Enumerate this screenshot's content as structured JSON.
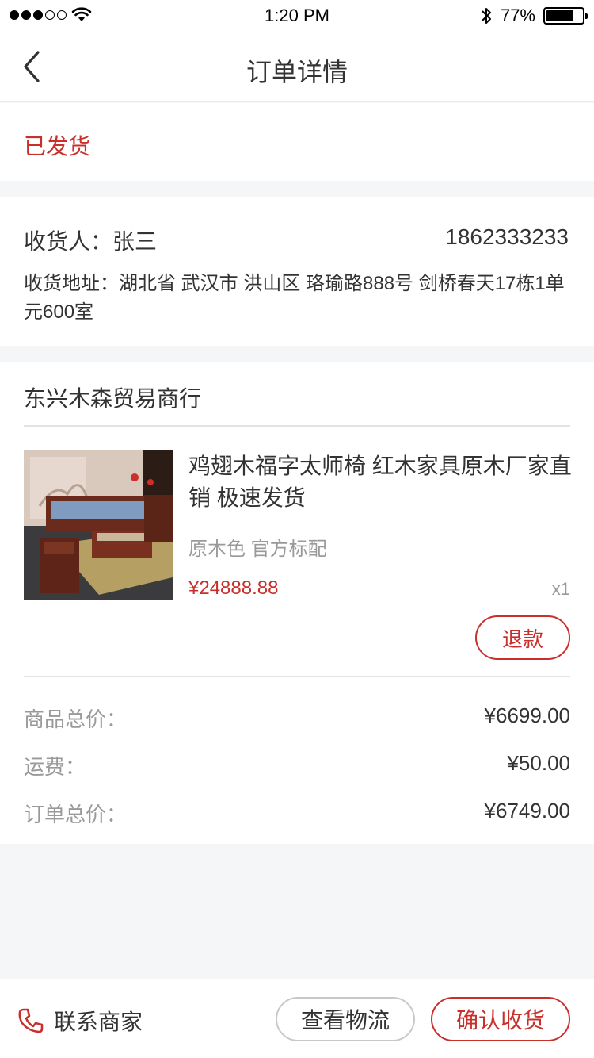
{
  "status_bar": {
    "signal_dots_filled": 3,
    "signal_dots_total": 5,
    "time": "1:20 PM",
    "battery_percent": "77%",
    "battery_level": 0.77
  },
  "nav": {
    "title": "订单详情",
    "back_icon": "chevron-left-icon"
  },
  "order": {
    "status": "已发货"
  },
  "receiver": {
    "name_label": "收货人：张三",
    "phone": "1862333233",
    "address": "收货地址：湖北省 武汉市 洪山区 珞瑜路888号 剑桥春天17栋1单元600室"
  },
  "shop": {
    "name": "东兴木森贸易商行"
  },
  "product": {
    "title": "鸡翅木福字太师椅 红木家具原木厂家直销 极速发货",
    "spec": "原木色 官方标配",
    "price": "¥24888.88",
    "quantity": "x1",
    "refund_label": "退款"
  },
  "summary": [
    {
      "label": "商品总价：",
      "value": "¥6699.00"
    },
    {
      "label": "运费：",
      "value": "¥50.00"
    },
    {
      "label": "订单总价：",
      "value": "¥6749.00"
    }
  ],
  "bottom": {
    "contact_label": "联系商家",
    "logistics_label": "查看物流",
    "confirm_label": "确认收货"
  },
  "colors": {
    "accent": "#c9302c",
    "background": "#f5f6f8",
    "muted_text": "#999999"
  }
}
